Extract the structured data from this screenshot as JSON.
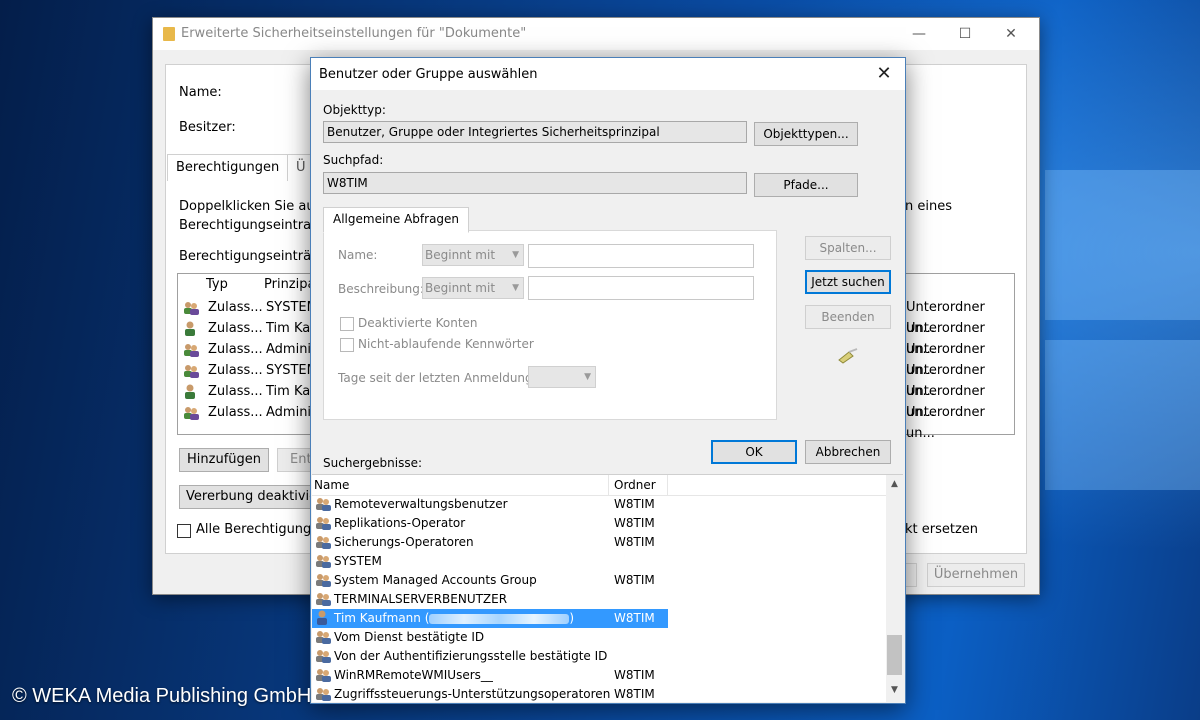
{
  "back_window": {
    "title": "Erweiterte Sicherheitseinstellungen für \"Dokumente\"",
    "name_label": "Name:",
    "owner_label": "Besitzer:",
    "tabs": [
      "Berechtigungen",
      "Ü"
    ],
    "intro_text_1": "Doppelklicken Sie au",
    "intro_text_2": "Berechtigungseintrag",
    "intro_text_right": "n eines",
    "entries_label": "Berechtigungseinträg",
    "columns": {
      "type": "Typ",
      "principal": "Prinzipa"
    },
    "rows": [
      {
        "icon": "group-icon",
        "type": "Zulass...",
        "principal": "SYSTEM",
        "applies": "Unterordner un..."
      },
      {
        "icon": "user-icon",
        "type": "Zulass...",
        "principal": "Tim Kau",
        "applies": "Unterordner un..."
      },
      {
        "icon": "group-icon",
        "type": "Zulass...",
        "principal": "Adminis",
        "applies": "Unterordner un..."
      },
      {
        "icon": "group-icon",
        "type": "Zulass...",
        "principal": "SYSTEM",
        "applies": "Unterordner un..."
      },
      {
        "icon": "user-icon",
        "type": "Zulass...",
        "principal": "Tim Kau",
        "applies": "Unterordner un..."
      },
      {
        "icon": "group-icon",
        "type": "Zulass...",
        "principal": "Adminis",
        "applies": "Unterordner un..."
      }
    ],
    "add_button": "Hinzufügen",
    "remove_button": "Ent",
    "inheritance_button": "Vererbung deaktivie",
    "replace_checkbox_label": "Alle Berechtigungs",
    "replace_text_right": "kt ersetzen",
    "apply_button": "Übernehmen"
  },
  "dialog": {
    "title": "Benutzer oder Gruppe auswählen",
    "object_type_label": "Objekttyp:",
    "object_type_value": "Benutzer, Gruppe oder Integriertes Sicherheitsprinzipal",
    "object_types_button": "Objekttypen...",
    "search_path_label": "Suchpfad:",
    "search_path_value": "W8TIM",
    "paths_button": "Pfade...",
    "tab_label": "Allgemeine Abfragen",
    "name_label": "Name:",
    "name_combo": "Beginnt mit",
    "description_label": "Beschreibung:",
    "description_combo": "Beginnt mit",
    "disabled_accounts": "Deaktivierte Konten",
    "non_expiring": "Nicht-ablaufende Kennwörter",
    "days_label": "Tage seit der letzten Anmeldung:",
    "columns_button": "Spalten...",
    "search_now_button": "Jetzt suchen",
    "stop_button": "Beenden",
    "ok_button": "OK",
    "cancel_button": "Abbrechen",
    "results_label": "Suchergebnisse:",
    "results_columns": {
      "name": "Name",
      "folder": "Ordner"
    },
    "results": [
      {
        "name": "Remoteverwaltungsbenutzer",
        "folder": "W8TIM",
        "icon": "group-icon"
      },
      {
        "name": "Replikations-Operator",
        "folder": "W8TIM",
        "icon": "group-icon"
      },
      {
        "name": "Sicherungs-Operatoren",
        "folder": "W8TIM",
        "icon": "group-icon"
      },
      {
        "name": "SYSTEM",
        "folder": "",
        "icon": "group-icon"
      },
      {
        "name": "System Managed Accounts Group",
        "folder": "W8TIM",
        "icon": "group-icon"
      },
      {
        "name": "TERMINALSERVERBENUTZER",
        "folder": "",
        "icon": "group-icon"
      },
      {
        "name": "Tim Kaufmann (",
        "folder": "W8TIM",
        "icon": "user-icon",
        "selected": true
      },
      {
        "name": "Vom Dienst bestätigte ID",
        "folder": "",
        "icon": "group-icon"
      },
      {
        "name": "Von der Authentifizierungsstelle bestätigte ID",
        "folder": "",
        "icon": "group-icon"
      },
      {
        "name": "WinRMRemoteWMIUsers__",
        "folder": "W8TIM",
        "icon": "group-icon"
      },
      {
        "name": "Zugriffssteuerungs-Unterstützungsoperatoren",
        "folder": "W8TIM",
        "icon": "group-icon"
      }
    ]
  },
  "watermark": "© WEKA Media Publishing GmbH",
  "colors": {
    "selection": "#3399ff",
    "accent": "#0078d7"
  }
}
